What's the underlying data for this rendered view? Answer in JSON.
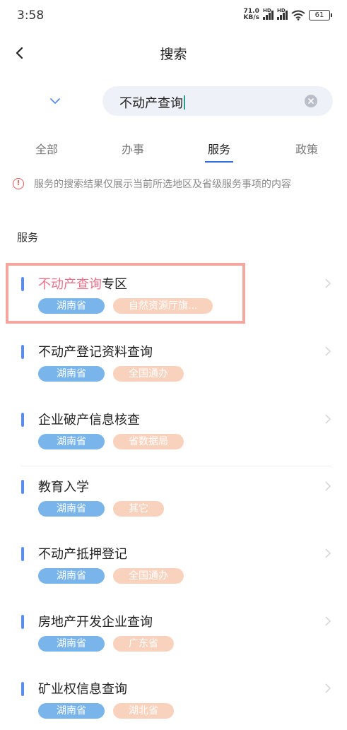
{
  "status_bar": {
    "time": "3:58",
    "net_speed_value": "71.0",
    "net_speed_unit": "KB/s",
    "hd_label": "HD",
    "battery": "61"
  },
  "nav": {
    "title": "搜索",
    "back_icon": "chevron-left-icon"
  },
  "search": {
    "region_icon": "chevron-down-icon",
    "query": "不动产查询",
    "clear_icon": "clear-circle-icon"
  },
  "tabs": [
    {
      "label": "全部",
      "active": false
    },
    {
      "label": "办事",
      "active": false
    },
    {
      "label": "服务",
      "active": true
    },
    {
      "label": "政策",
      "active": false
    }
  ],
  "notice": {
    "icon": "info-icon",
    "text": "服务的搜索结果仅展示当前所选地区及省级服务事项的内容"
  },
  "section_title": "服务",
  "services": [
    {
      "title_highlight": "不动产查询",
      "title_rest": "专区",
      "province": "湖南省",
      "dept": "自然资源厅旗..."
    },
    {
      "title_highlight": "",
      "title_rest": "不动产登记资料查询",
      "province": "湖南省",
      "dept": "全国通办"
    },
    {
      "title_highlight": "",
      "title_rest": "企业破产信息核查",
      "province": "湖南省",
      "dept": "省数据局"
    },
    {
      "title_highlight": "",
      "title_rest": "教育入学",
      "province": "湖南省",
      "dept": "其它"
    },
    {
      "title_highlight": "",
      "title_rest": "不动产抵押登记",
      "province": "湖南省",
      "dept": "全国通办"
    },
    {
      "title_highlight": "",
      "title_rest": "房地产开发企业查询",
      "province": "湖南省",
      "dept": "广东省"
    },
    {
      "title_highlight": "",
      "title_rest": "矿业权信息查询",
      "province": "湖南省",
      "dept": "湖北省"
    }
  ],
  "colors": {
    "accent": "#2e6de0",
    "highlight_text": "#e8728a",
    "province_tag": "#79b4ea",
    "dept_tag": "#f9d2bd",
    "frame": "#f4a79f"
  }
}
